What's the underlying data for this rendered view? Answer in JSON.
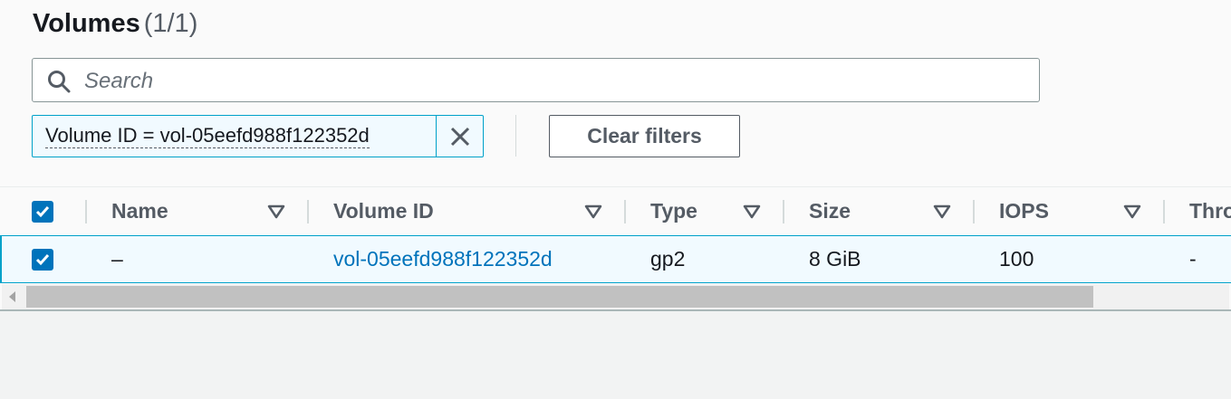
{
  "header": {
    "title": "Volumes",
    "count": "(1/1)"
  },
  "search": {
    "placeholder": "Search",
    "icon": "search-icon"
  },
  "filter": {
    "token_label": "Volume ID = vol-05eefd988f122352d",
    "dismiss_icon": "close-icon"
  },
  "clear_filters_label": "Clear filters",
  "table": {
    "columns": [
      "Name",
      "Volume ID",
      "Type",
      "Size",
      "IOPS",
      "Thro"
    ],
    "rows": [
      {
        "selected": true,
        "name": "–",
        "volume_id": "vol-05eefd988f122352d",
        "type": "gp2",
        "size": "8 GiB",
        "iops": "100",
        "throughput": "-"
      }
    ]
  },
  "colors": {
    "accent": "#0073bb",
    "selected_bg": "#f1faff",
    "selected_border": "#00a1c9"
  }
}
